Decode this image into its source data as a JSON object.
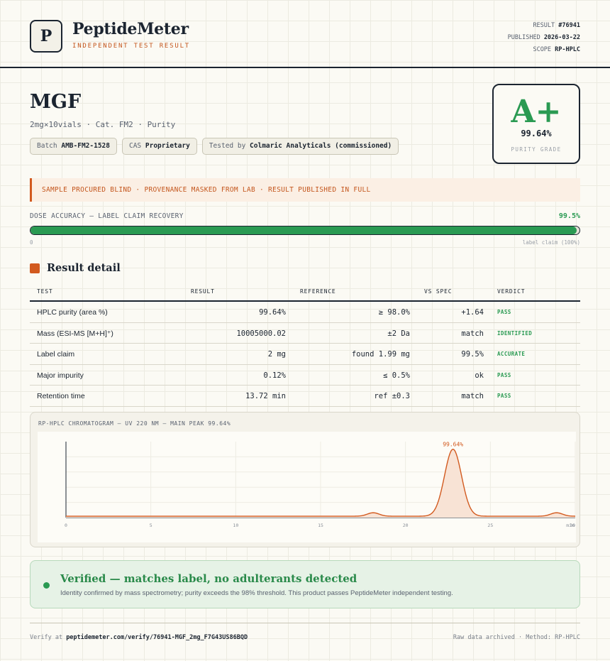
{
  "brand": {
    "logo_letter": "P",
    "name": "PeptideMeter",
    "subtitle": "INDEPENDENT TEST RESULT"
  },
  "meta": {
    "result_label": "RESULT",
    "result_value": "#76941",
    "published_label": "PUBLISHED",
    "published_value": "2026-03-22",
    "scope_label": "SCOPE",
    "scope_value": "RP-HPLC"
  },
  "product": {
    "title": "MGF",
    "subtitle": "2mg×10vials · Cat. FM2 · Purity",
    "chips": [
      {
        "label": "Batch",
        "value": "AMB-FM2-1528"
      },
      {
        "label": "CAS",
        "value": "Proprietary"
      },
      {
        "label": "Tested by",
        "value": "Colmaric Analyticals (commissioned)"
      }
    ]
  },
  "grade": {
    "letter": "A+",
    "percent": "99.64%",
    "label": "PURITY GRADE"
  },
  "notice": "SAMPLE PROCURED BLIND · PROVENANCE MASKED FROM LAB · RESULT PUBLISHED IN FULL",
  "dose": {
    "label": "DOSE ACCURACY — LABEL CLAIM RECOVERY",
    "value": "99.5%",
    "fraction": 0.995,
    "min_label": "0",
    "max_label": "label claim (100%)"
  },
  "detail": {
    "title": "Result detail",
    "headers": {
      "test": "TEST",
      "result": "RESULT",
      "reference": "REFERENCE",
      "vs_spec": "VS SPEC",
      "verdict": "VERDICT"
    },
    "rows": [
      {
        "test": "HPLC purity (area %)",
        "result": "99.64%",
        "reference": "≥ 98.0%",
        "vs_spec": "+1.64",
        "verdict": "PASS"
      },
      {
        "test": "Mass (ESI-MS [M+H]⁺)",
        "result": "10005000.02",
        "reference": "±2 Da",
        "vs_spec": "match",
        "verdict": "IDENTIFIED"
      },
      {
        "test": "Label claim",
        "result": "2 mg",
        "reference": "found 1.99 mg",
        "vs_spec": "99.5%",
        "verdict": "ACCURATE"
      },
      {
        "test": "Major impurity",
        "result": "0.12%",
        "reference": "≤ 0.5%",
        "vs_spec": "ok",
        "verdict": "PASS"
      },
      {
        "test": "Retention time",
        "result": "13.72 min",
        "reference": "ref ±0.3",
        "vs_spec": "match",
        "verdict": "PASS"
      }
    ]
  },
  "chart_data": {
    "type": "area",
    "title": "RP-HPLC CHROMATOGRAM — UV 220 NM — MAIN PEAK 99.64%",
    "xlabel": "",
    "ylabel": "",
    "xlim": [
      0,
      30
    ],
    "ylim": [
      0,
      110
    ],
    "x_ticks": [
      "0",
      "5",
      "10",
      "15",
      "20",
      "25",
      "30",
      "min"
    ],
    "grid": true,
    "baseline": 2,
    "peaks": [
      {
        "center": 18.1,
        "height": 5,
        "width": 0.35
      },
      {
        "center": 22.8,
        "height": 97,
        "width": 0.5
      },
      {
        "center": 28.9,
        "height": 5,
        "width": 0.35
      }
    ],
    "annotation": {
      "x": 22.8,
      "text": "99.64%"
    },
    "line_color": "#d25a1f",
    "fill_color": "#f8e3d5"
  },
  "verified": {
    "title": "Verified — matches label, no adulterants detected",
    "text": "Identity confirmed by mass spectrometry; purity exceeds the 98% threshold. This product passes PeptideMeter independent testing."
  },
  "footer": {
    "verify_prefix": "Verify at",
    "verify_url": "peptidemeter.com/verify/76941-MGF_2mg_F7G43US86BQD",
    "right": "Raw data archived · Method: RP-HPLC"
  },
  "colors": {
    "accent": "#d25a1f",
    "pass": "#2a9a52",
    "ink": "#1b2430"
  }
}
